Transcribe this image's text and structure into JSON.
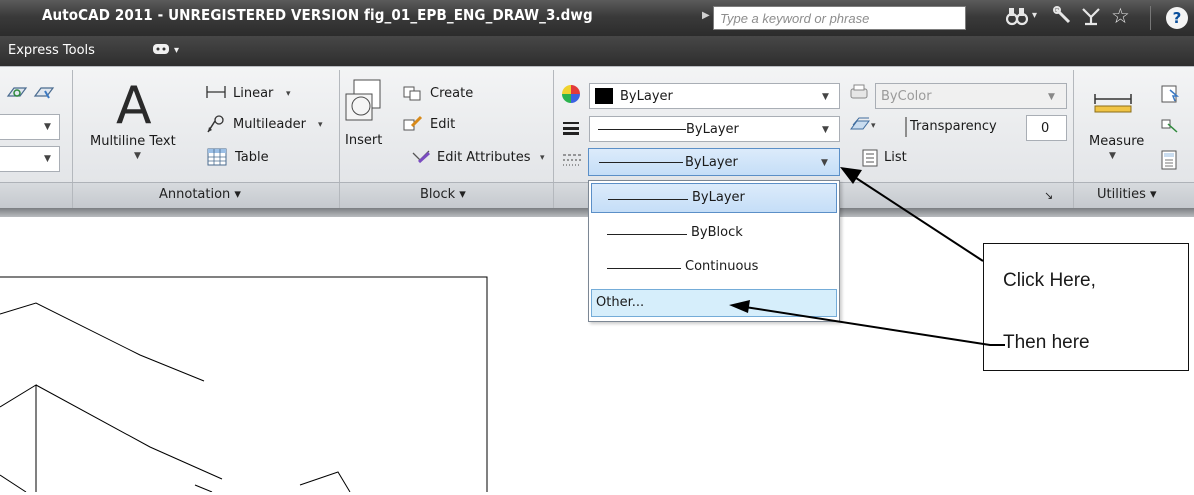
{
  "titlebar": {
    "app_title": "AutoCAD 2011 - UNREGISTERED VERSION    fig_01_EPB_ENG_DRAW_3.dwg",
    "search_placeholder": "Type a keyword or phrase",
    "icons": [
      "binoculars-icon",
      "wrench-icon",
      "satellite-icon",
      "star-icon",
      "help-icon"
    ],
    "help_label": "?"
  },
  "menubar": {
    "express_tools": "Express Tools"
  },
  "ribbon": {
    "annotation": {
      "multiline_text": "Multiline Text",
      "multiline_text_glyph": "A",
      "linear": "Linear",
      "multileader": "Multileader",
      "table": "Table",
      "panel_label": "Annotation ▾"
    },
    "block": {
      "insert": "Insert",
      "create": "Create",
      "edit": "Edit",
      "edit_attributes": "Edit Attributes",
      "panel_label": "Block ▾"
    },
    "properties": {
      "color_value": "ByLayer",
      "lineweight_value": "ByLayer",
      "linetype_value": "ByLayer",
      "plot_style_value": "ByColor",
      "transparency_label": "Transparency",
      "transparency_value": "0",
      "list_label": "List",
      "dialog_launcher": "↘"
    },
    "utilities": {
      "measure": "Measure",
      "panel_label": "Utilities ▾"
    },
    "colors": {
      "color_swatch": "#000000",
      "selected_bg": "#c5def7",
      "highlight_border": "#5b8fc7"
    }
  },
  "linetype_dropdown": {
    "items": [
      "ByLayer",
      "ByBlock",
      "Continuous"
    ],
    "selected": "ByLayer",
    "other": "Other..."
  },
  "callout": {
    "line1": "Click Here,",
    "line2": "Then here"
  }
}
